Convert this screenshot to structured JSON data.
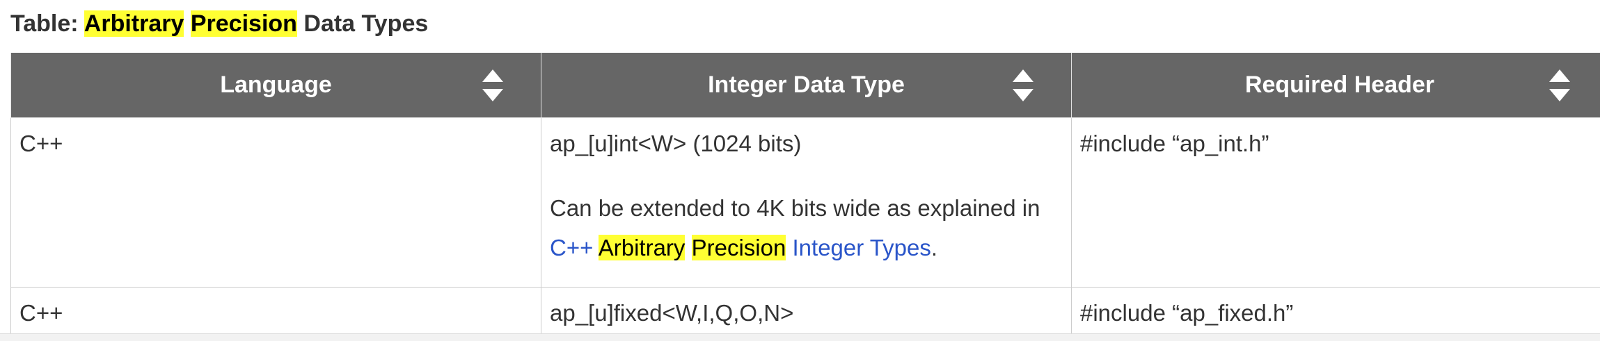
{
  "caption": {
    "prefix": "Table: ",
    "hl1": "Arbitrary",
    "hl2": "Precision",
    "suffix": " Data Types"
  },
  "headers": {
    "language": "Language",
    "integer_type": "Integer Data Type",
    "required_header": "Required Header"
  },
  "rows": [
    {
      "language": "C++",
      "type_line": "ap_[u]int<W> (1024 bits)",
      "note_text": "Can be extended to 4K bits wide as explained in ",
      "note_link_part1": "C++",
      "note_link_hl1": "Arbitrary",
      "note_link_hl2": "Precision",
      "note_link_part2": "Integer Types",
      "note_end": ".",
      "header": "#include “ap_int.h”"
    },
    {
      "language": "C++",
      "type_line": "ap_[u]fixed<W,I,Q,O,N>",
      "header": "#include “ap_fixed.h”"
    }
  ],
  "icons": {
    "sort": "sort-icon"
  },
  "colors": {
    "header_bg": "#666666",
    "highlight": "#ffff33",
    "link": "#2a55c9"
  }
}
